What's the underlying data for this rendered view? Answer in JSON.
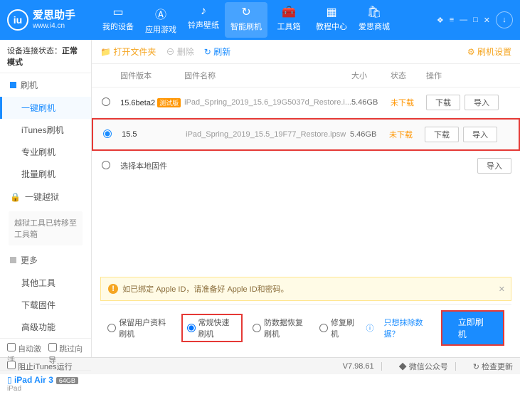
{
  "header": {
    "app_name": "爱思助手",
    "site": "www.i4.cn",
    "nav": [
      "我的设备",
      "应用游戏",
      "铃声壁纸",
      "智能刷机",
      "工具箱",
      "教程中心",
      "爱思商城"
    ],
    "nav_active": 3,
    "win_icons": [
      "❖",
      "≡",
      "—",
      "□",
      "✕"
    ]
  },
  "sidebar": {
    "conn_label": "设备连接状态：",
    "conn_value": "正常模式",
    "g1": {
      "title": "刷机",
      "items": [
        "一键刷机",
        "iTunes刷机",
        "专业刷机",
        "批量刷机"
      ],
      "active": 0
    },
    "g2": {
      "title": "一键越狱",
      "note": "越狱工具已转移至工具箱"
    },
    "g3": {
      "title": "更多",
      "items": [
        "其他工具",
        "下载固件",
        "高级功能"
      ]
    },
    "chk_auto": "自动激活",
    "chk_skip": "跳过向导",
    "device": {
      "name": "iPad Air 3",
      "cap": "64GB",
      "type": "iPad"
    }
  },
  "toolbar": {
    "open": "打开文件夹",
    "del": "删除",
    "refresh": "刷新",
    "settings": "刷机设置"
  },
  "table": {
    "headers": {
      "ver": "固件版本",
      "name": "固件名称",
      "size": "大小",
      "status": "状态",
      "ops": "操作"
    },
    "btn_dl": "下载",
    "btn_imp": "导入",
    "rows": [
      {
        "ver": "15.6beta2",
        "tag": "测试版",
        "name": "iPad_Spring_2019_15.6_19G5037d_Restore.i...",
        "size": "5.46GB",
        "status": "未下载",
        "selected": false
      },
      {
        "ver": "15.5",
        "tag": "",
        "name": "iPad_Spring_2019_15.5_19F77_Restore.ipsw",
        "size": "5.46GB",
        "status": "未下载",
        "selected": true
      }
    ],
    "local": "选择本地固件"
  },
  "warn": {
    "icon": "!",
    "text": "如已绑定 Apple ID，请准备好 Apple ID和密码。"
  },
  "flash": {
    "opt1": "保留用户资料刷机",
    "opt2": "常规快速刷机",
    "opt3": "防数据恢复刷机",
    "opt4": "修复刷机",
    "link": "只想抹除数据？",
    "btn": "立即刷机"
  },
  "status": {
    "block": "阻止iTunes运行",
    "ver": "V7.98.61",
    "wechat": "微信公众号",
    "update": "检查更新"
  }
}
